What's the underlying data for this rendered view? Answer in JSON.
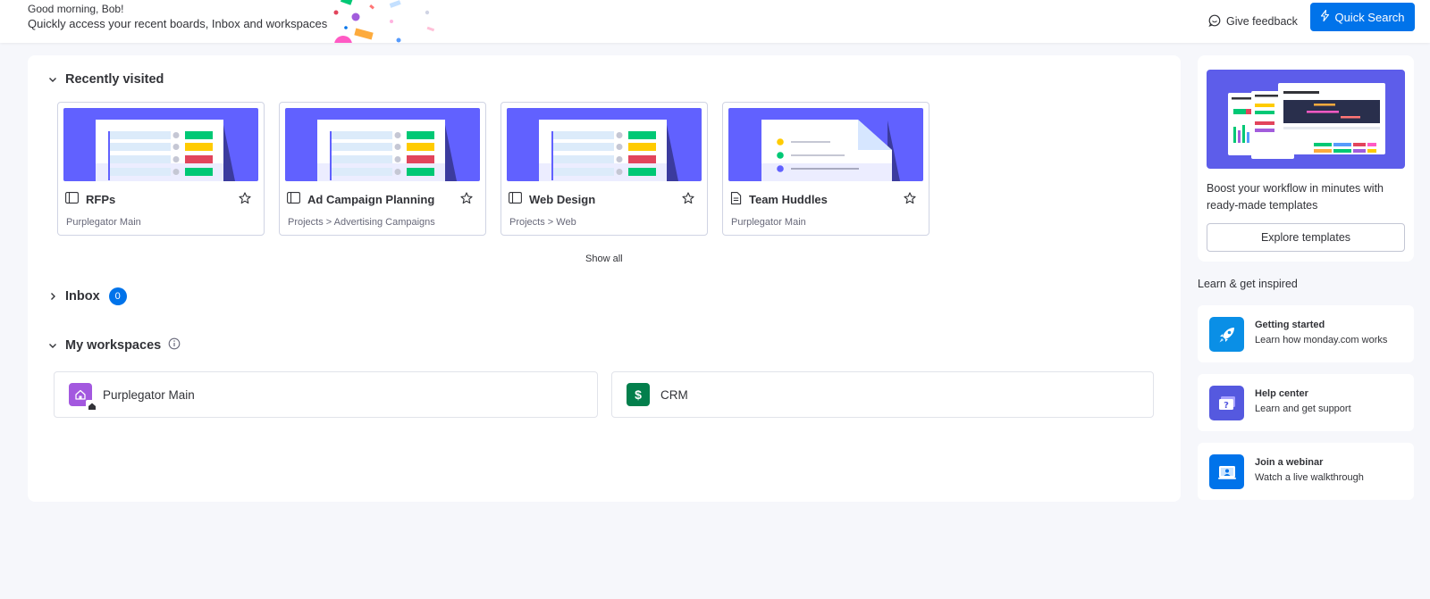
{
  "header": {
    "greeting": "Good morning, Bob!",
    "subtitle": "Quickly access your recent boards, Inbox and workspaces",
    "feedback_label": "Give feedback",
    "quick_search_label": "Quick Search"
  },
  "recently_visited": {
    "title": "Recently visited",
    "show_all_label": "Show all",
    "cards": [
      {
        "name": "RFPs",
        "path": "Purplegator Main",
        "icon": "board-icon"
      },
      {
        "name": "Ad Campaign Planning",
        "path": "Projects > Advertising Campaigns",
        "icon": "board-icon"
      },
      {
        "name": "Web Design",
        "path": "Projects > Web",
        "icon": "board-icon"
      },
      {
        "name": "Team Huddles",
        "path": "Purplegator Main",
        "icon": "doc-icon"
      }
    ]
  },
  "inbox": {
    "title": "Inbox",
    "count": "0"
  },
  "workspaces": {
    "title": "My workspaces",
    "items": [
      {
        "name": "Purplegator Main",
        "icon": "home-icon",
        "color": "#a358df"
      },
      {
        "name": "CRM",
        "icon": "dollar-icon",
        "letter": "$",
        "color": "#037f4c"
      }
    ]
  },
  "templates": {
    "text": "Boost your workflow in minutes with ready-made templates",
    "button_label": "Explore templates"
  },
  "learn": {
    "title": "Learn & get inspired",
    "items": [
      {
        "title": "Getting started",
        "subtitle": "Learn how monday.com works",
        "icon": "rocket-icon",
        "color": "#0a8fe6"
      },
      {
        "title": "Help center",
        "subtitle": "Learn and get support",
        "icon": "help-icon",
        "color": "#5559df"
      },
      {
        "title": "Join a webinar",
        "subtitle": "Watch a live walkthrough",
        "icon": "webinar-icon",
        "color": "#0073ea"
      }
    ]
  },
  "colors": {
    "primary": "#0073ea",
    "thumb_bg": "#6161ff",
    "status_green": "#00c875",
    "status_yellow": "#ffcb00",
    "status_red": "#e2445c"
  }
}
